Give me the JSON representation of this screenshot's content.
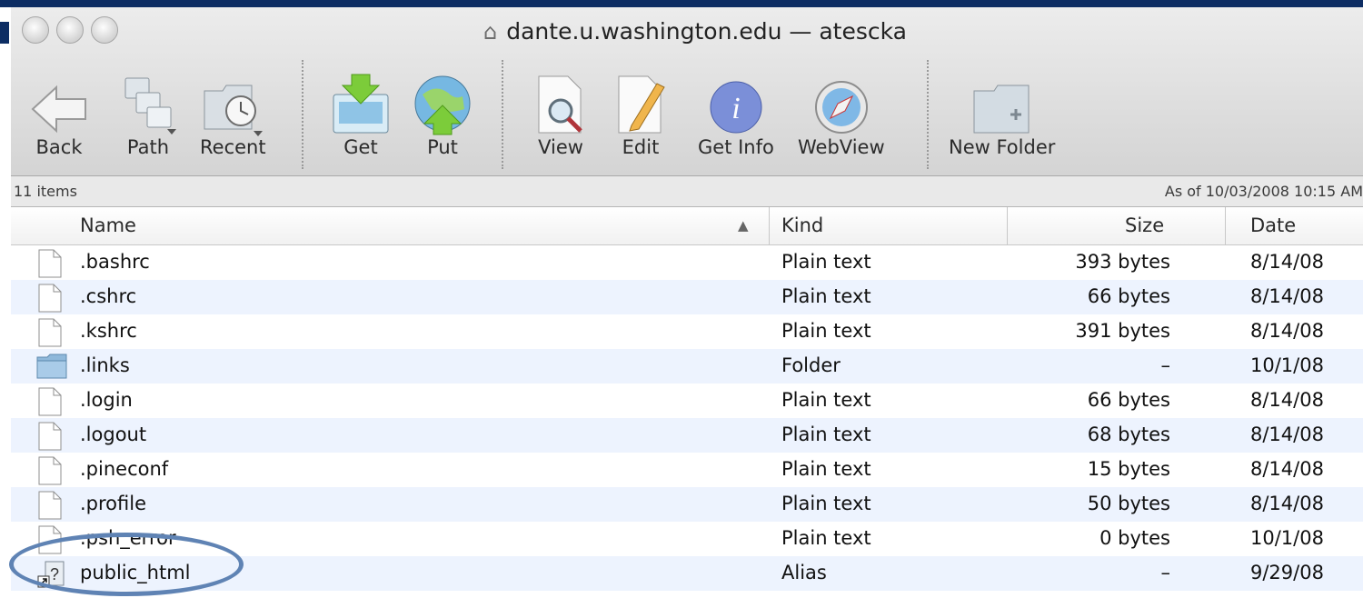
{
  "window": {
    "title": "dante.u.washington.edu — atescka",
    "title_icon": "home-icon"
  },
  "toolbar": {
    "buttons": [
      {
        "label": "Back",
        "icon": "back-arrow-icon"
      },
      {
        "label": "Path",
        "icon": "path-icon"
      },
      {
        "label": "Recent",
        "icon": "recent-icon"
      },
      {
        "label": "Get",
        "icon": "get-download-icon"
      },
      {
        "label": "Put",
        "icon": "put-upload-icon"
      },
      {
        "label": "View",
        "icon": "view-document-icon"
      },
      {
        "label": "Edit",
        "icon": "edit-document-icon"
      },
      {
        "label": "Get Info",
        "icon": "info-icon"
      },
      {
        "label": "WebView",
        "icon": "compass-icon"
      },
      {
        "label": "New Folder",
        "icon": "new-folder-icon"
      }
    ]
  },
  "status": {
    "items_count": "11 items",
    "as_of": "As of 10/03/2008 10:15 AM"
  },
  "columns": {
    "name": "Name",
    "kind": "Kind",
    "size": "Size",
    "date": "Date"
  },
  "files": [
    {
      "name": ".bashrc",
      "kind": "Plain text",
      "size": "393 bytes",
      "date": "8/14/08",
      "icon": "document-icon"
    },
    {
      "name": ".cshrc",
      "kind": "Plain text",
      "size": "66 bytes",
      "date": "8/14/08",
      "icon": "document-icon"
    },
    {
      "name": ".kshrc",
      "kind": "Plain text",
      "size": "391 bytes",
      "date": "8/14/08",
      "icon": "document-icon"
    },
    {
      "name": ".links",
      "kind": "Folder",
      "size": "–",
      "date": "10/1/08",
      "icon": "folder-icon"
    },
    {
      "name": ".login",
      "kind": "Plain text",
      "size": "66 bytes",
      "date": "8/14/08",
      "icon": "document-icon"
    },
    {
      "name": ".logout",
      "kind": "Plain text",
      "size": "68 bytes",
      "date": "8/14/08",
      "icon": "document-icon"
    },
    {
      "name": ".pineconf",
      "kind": "Plain text",
      "size": "15 bytes",
      "date": "8/14/08",
      "icon": "document-icon"
    },
    {
      "name": ".profile",
      "kind": "Plain text",
      "size": "50 bytes",
      "date": "8/14/08",
      "icon": "document-icon"
    },
    {
      "name": ".psh_error",
      "kind": "Plain text",
      "size": "0 bytes",
      "date": "10/1/08",
      "icon": "document-icon"
    },
    {
      "name": "public_html",
      "kind": "Alias",
      "size": "–",
      "date": "9/29/08",
      "icon": "alias-unknown-icon"
    }
  ],
  "colors": {
    "accent": "#0d2d63",
    "row_alt": "#edf3fe",
    "highlight_circle": "#5f83b4"
  }
}
